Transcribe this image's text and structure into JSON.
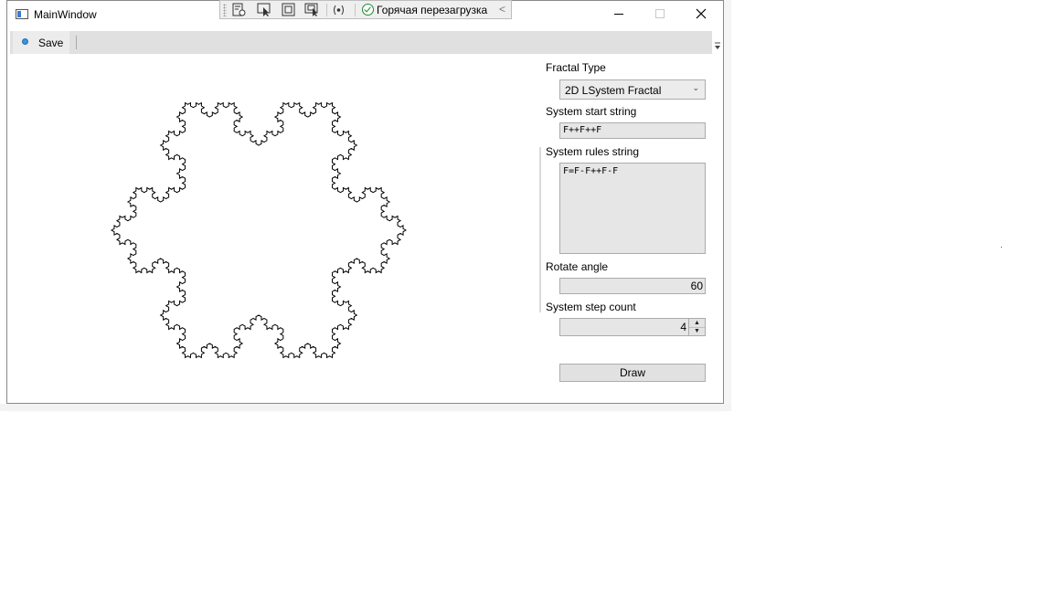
{
  "window": {
    "title": "MainWindow",
    "app_icon": "window-app-icon",
    "controls": [
      "minimize-icon",
      "maximize-icon",
      "close-icon"
    ]
  },
  "dev_toolbar": {
    "icons": [
      "visual-tree-icon",
      "select-element-icon",
      "display-layout-adorners-icon",
      "track-focus-icon",
      "binding-failures-icon"
    ],
    "hot_reload_label": "Горячая перезагрузка",
    "hot_reload_status_icon": "check-circle-icon",
    "collapse_icon": "chevron-left-icon"
  },
  "toolbar": {
    "save_label": "Save",
    "overflow_icon": "toolbar-overflow-icon"
  },
  "panel": {
    "fractal_type_label": "Fractal Type",
    "fractal_type_value": "2D LSystem Fractal",
    "start_label": "System start string",
    "start_value": "F++F++F",
    "rules_label": "System rules string",
    "rules_value": "F=F-F++F-F",
    "angle_label": "Rotate angle",
    "angle_value": "60",
    "steps_label": "System step count",
    "steps_value": "4",
    "draw_label": "Draw"
  },
  "fractal": {
    "type": "Koch snowflake",
    "axiom": "F++F++F",
    "rule": "F=F-F++F-F",
    "angle_deg": 60,
    "iterations": 4,
    "stroke_color": "#000000"
  }
}
